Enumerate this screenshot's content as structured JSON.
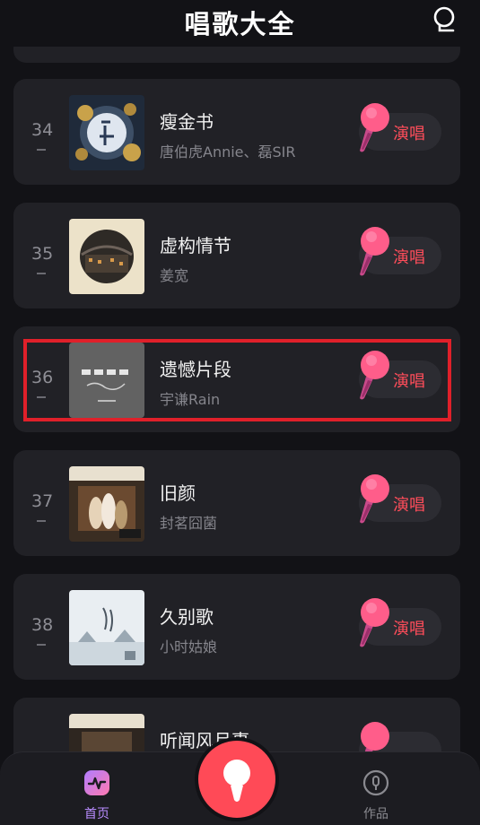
{
  "header": {
    "title": "唱歌大全"
  },
  "sing_label": "演唱",
  "songs": [
    {
      "rank": "34",
      "title": "瘦金书",
      "artist": "唐伯虎Annie、磊SIR"
    },
    {
      "rank": "35",
      "title": "虚构情节",
      "artist": "姜宽"
    },
    {
      "rank": "36",
      "title": "遗憾片段",
      "artist": "宇谦Rain"
    },
    {
      "rank": "37",
      "title": "旧颜",
      "artist": "封茗囧菌"
    },
    {
      "rank": "38",
      "title": "久别歌",
      "artist": "小时姑娘"
    },
    {
      "rank": "",
      "title": "听闻风月事",
      "artist": ""
    }
  ],
  "tabbar": {
    "home_label": "首页",
    "works_label": "作品"
  },
  "colors": {
    "accent": "#ff4d5a",
    "highlight_box": "#e0202a",
    "card": "#212126",
    "background": "#121216"
  },
  "icons": [
    "profile-icon",
    "microphone-icon",
    "pulse-icon",
    "works-icon"
  ]
}
